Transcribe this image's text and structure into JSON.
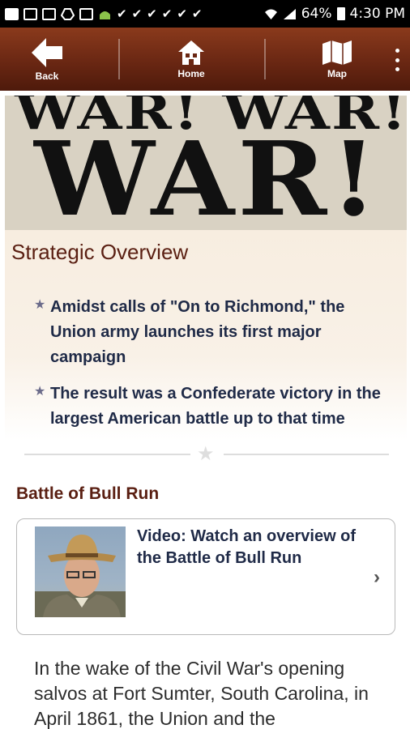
{
  "status_bar": {
    "battery_percent": "64%",
    "time": "4:30 PM"
  },
  "nav": {
    "back_label": "Back",
    "home_label": "Home",
    "map_label": "Map"
  },
  "hero": {
    "line1": "WAR! WAR!",
    "line2": "WAR!"
  },
  "overview": {
    "title": "Strategic Overview",
    "bullets": [
      "Amidst calls of \"On to Richmond,\" the Union army launches its first major campaign",
      "The result was a Confederate victory in the largest American battle up to that time"
    ]
  },
  "section": {
    "title": "Battle of Bull Run"
  },
  "video": {
    "title": "Video: Watch an overview of the Battle of Bull Run"
  },
  "body": {
    "text": "In the wake of the Civil War's opening salvos at Fort Sumter, South Carolina, in April 1861, the Union and the"
  },
  "icons": {
    "back": "back-arrow-icon",
    "home": "home-icon",
    "map": "map-icon",
    "more": "more-vert-icon",
    "chevron": "chevron-right-icon",
    "star": "star-icon"
  },
  "colors": {
    "nav_brown": "#6a2713",
    "title_maroon": "#5a1f12",
    "text_navy": "#1f2a47"
  }
}
